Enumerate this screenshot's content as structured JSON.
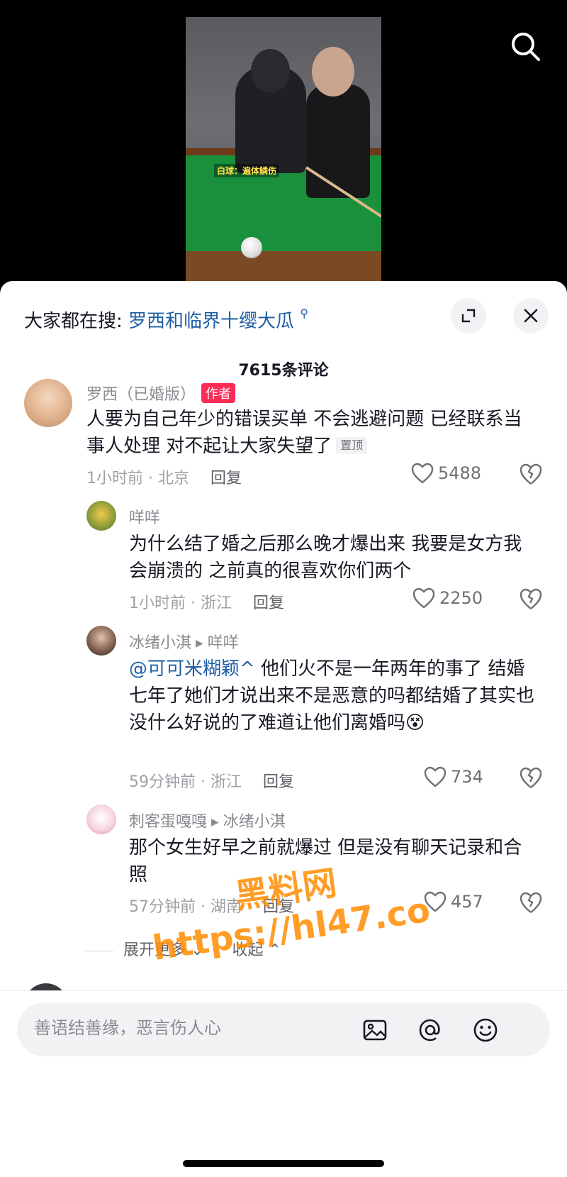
{
  "video": {
    "caption": "白球：遍体鳞伤"
  },
  "search_bar": {
    "prefix": "大家都在搜:",
    "keyword": "罗西和临界十缨大瓜",
    "mag_glyph": "⚲"
  },
  "comments_header": {
    "count_label": "7615条评论"
  },
  "comments": [
    {
      "name": "罗西（已婚版）",
      "badge": "作者",
      "text": "人要为自己年少的错误买单 不会逃避问题 已经联系当事人处理 对不起让大家失望了",
      "pin": "置顶",
      "meta": "1小时前 · 北京",
      "reply": "回复",
      "likes": "5488"
    },
    {
      "name": "咩咩",
      "text": "为什么结了婚之后那么晚才爆出来 我要是女方我会崩溃的 之前真的很喜欢你们两个",
      "meta": "1小时前 · 浙江",
      "reply": "回复",
      "likes": "2250"
    },
    {
      "name": "冰绪小淇",
      "reply_to": "咩咩",
      "mention": "@可可米糊颖^",
      "text": " 他们火不是一年两年的事了 结婚七年了她们才说出来不是恶意的吗都结婚了其实也没什么好说的了难道让他们离婚吗",
      "emoji": "😵",
      "meta": "59分钟前 · 浙江",
      "reply": "回复",
      "likes": "734"
    },
    {
      "name": "刺客蛋嘎嘎",
      "reply_to": "冰绪小淇",
      "text": "那个女生好早之前就爆过 但是没有聊天记录和合照",
      "meta": "57分钟前 · 湖南",
      "reply": "回复",
      "likes": "457"
    }
  ],
  "expand": {
    "more_label": "展开更多 ⌄",
    "collapse_label": "收起 ⌃"
  },
  "watermark": {
    "line1": "黑料网",
    "line2": "https://hl47.co"
  },
  "composer": {
    "placeholder": "善语结善缘，恶言伤人心"
  },
  "colors": {
    "accent": "#fe2c55",
    "link": "#1f5fa8",
    "secondary_text": "#8a8b91"
  }
}
